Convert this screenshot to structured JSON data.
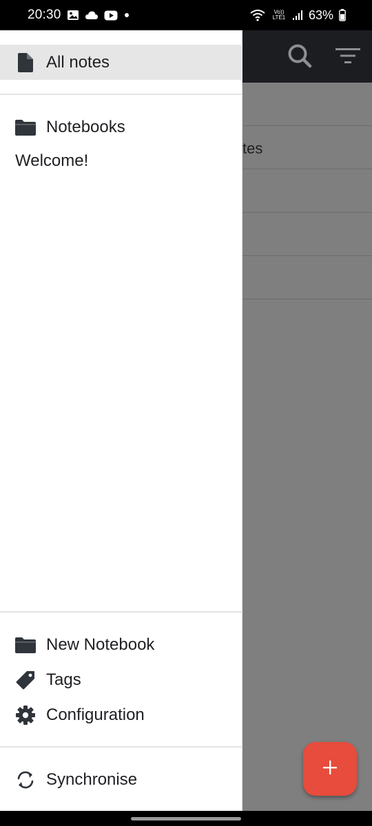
{
  "status_bar": {
    "time": "20:30",
    "battery": "63%",
    "network_label": "Vo)) LTE1",
    "icons": [
      "gallery-icon",
      "cloud-icon",
      "youtube-icon",
      "dot-icon",
      "wifi-icon",
      "signal-icon",
      "battery-icon"
    ]
  },
  "drawer": {
    "all_notes": "All notes",
    "notebooks_header": "Notebooks",
    "notebooks": [
      "Welcome!"
    ],
    "new_notebook": "New Notebook",
    "tags": "Tags",
    "configuration": "Configuration",
    "synchronise": "Synchronise"
  },
  "background": {
    "visible_row_text": "tes",
    "row_count": 5
  },
  "colors": {
    "accent": "#e74c3c",
    "header": "#1b1d21",
    "selected_item": "#e6e6e6",
    "scrim": "#7f7f7f",
    "icon": "#30343b"
  }
}
